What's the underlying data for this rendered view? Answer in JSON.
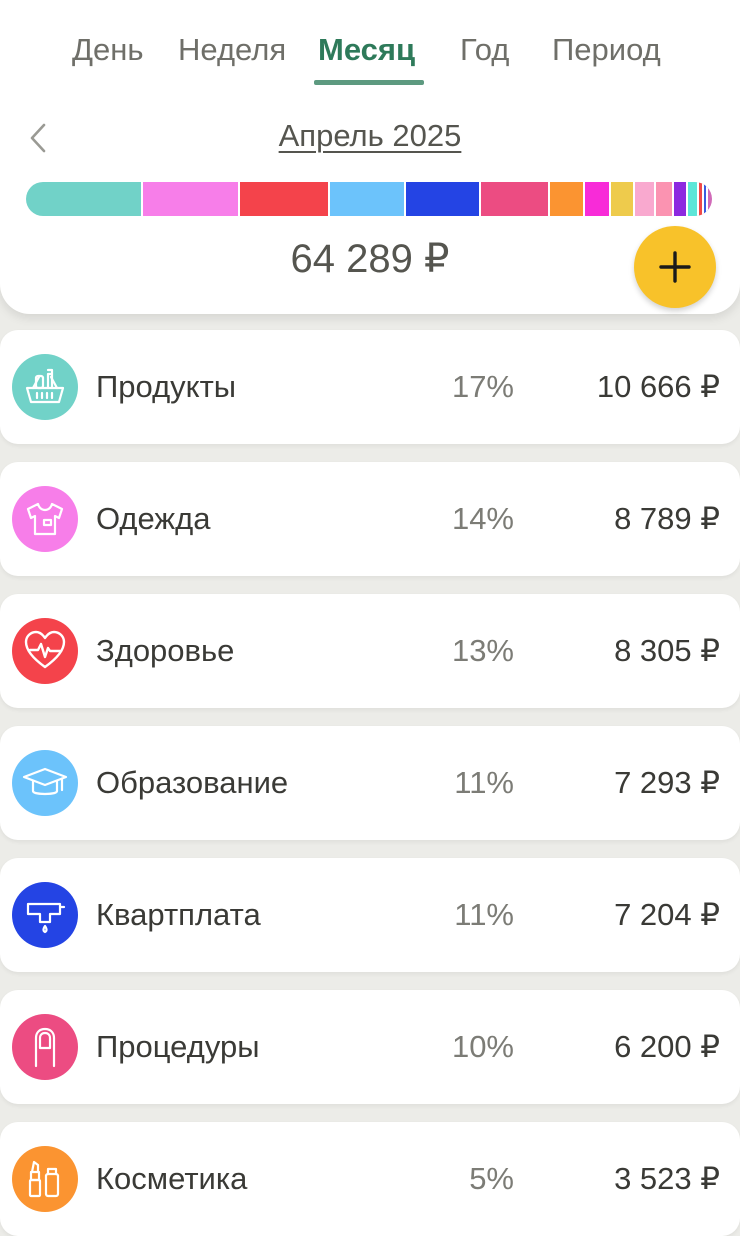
{
  "tabs": [
    {
      "label": "День",
      "active": false
    },
    {
      "label": "Неделя",
      "active": false
    },
    {
      "label": "Месяц",
      "active": true
    },
    {
      "label": "Год",
      "active": false
    },
    {
      "label": "Период",
      "active": false
    }
  ],
  "header": {
    "month_label": "Апрель 2025",
    "total": "64 289 ₽",
    "back_icon": "chevron-left-icon",
    "add_icon": "plus-icon"
  },
  "distribution_bar": [
    {
      "category": "Продукты",
      "color": "#71d2c8",
      "share": 17
    },
    {
      "category": "Одежда",
      "color": "#f77ee9",
      "share": 14
    },
    {
      "category": "Здоровье",
      "color": "#f4434b",
      "share": 13
    },
    {
      "category": "Образование",
      "color": "#6cc3fb",
      "share": 11
    },
    {
      "category": "Квартплата",
      "color": "#2444e4",
      "share": 11
    },
    {
      "category": "Процедуры",
      "color": "#ec4c82",
      "share": 10
    },
    {
      "category": "Косметика",
      "color": "#fb9431",
      "share": 5
    },
    {
      "color": "#f82bd8",
      "share": 3.8
    },
    {
      "color": "#eecb4c",
      "share": 3.5
    },
    {
      "color": "#f9a9cf",
      "share": 3.0
    },
    {
      "color": "#fb93b1",
      "share": 2.6
    },
    {
      "color": "#8d29e0",
      "share": 2.0
    },
    {
      "color": "#5de6d8",
      "share": 1.6
    },
    {
      "color": "#f04848",
      "share": 0.8
    },
    {
      "color": "#3b5bdf",
      "share": 0.6
    },
    {
      "color": "#d06ab8",
      "share": 0.5
    }
  ],
  "categories": [
    {
      "name": "Продукты",
      "percent": "17%",
      "amount": "10 666 ₽",
      "color": "#71d2c8",
      "icon": "grocery-basket-icon"
    },
    {
      "name": "Одежда",
      "percent": "14%",
      "amount": "8 789 ₽",
      "color": "#f77ee9",
      "icon": "tshirt-icon"
    },
    {
      "name": "Здоровье",
      "percent": "13%",
      "amount": "8 305 ₽",
      "color": "#f4434b",
      "icon": "heart-pulse-icon"
    },
    {
      "name": "Образование",
      "percent": "11%",
      "amount": "7 293 ₽",
      "color": "#6cc3fb",
      "icon": "graduation-cap-icon"
    },
    {
      "name": "Квартплата",
      "percent": "11%",
      "amount": "7 204 ₽",
      "color": "#2444e4",
      "icon": "faucet-icon"
    },
    {
      "name": "Процедуры",
      "percent": "10%",
      "amount": "6 200 ₽",
      "color": "#ec4c82",
      "icon": "nail-icon"
    },
    {
      "name": "Косметика",
      "percent": "5%",
      "amount": "3 523 ₽",
      "color": "#fb9431",
      "icon": "lipstick-icon"
    }
  ]
}
